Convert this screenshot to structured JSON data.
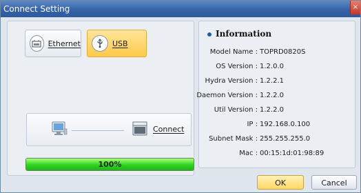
{
  "window": {
    "title": "Connect Setting"
  },
  "connection": {
    "ethernet_label": "Ethernet",
    "usb_label": "USB",
    "connect_label": "Connect"
  },
  "progress": {
    "value": 1.0,
    "label": "100%"
  },
  "information": {
    "title": "Information",
    "rows": [
      {
        "label": "Model Name :",
        "value": "TOPRD0820S"
      },
      {
        "label": "OS Version :",
        "value": "1.2.0.0"
      },
      {
        "label": "Hydra Version :",
        "value": "1.2.2.1"
      },
      {
        "label": "Daemon Version :",
        "value": "1.2.2.0"
      },
      {
        "label": "Util Version :",
        "value": "1.2.2.0"
      },
      {
        "label": "IP :",
        "value": "192.168.0.100"
      },
      {
        "label": "Subnet Mask :",
        "value": "255.255.255.0"
      },
      {
        "label": "Mac :",
        "value": "00:15:1d:01:98:89"
      }
    ]
  },
  "buttons": {
    "ok": "OK",
    "cancel": "Cancel"
  },
  "icons": {
    "ethernet": "ethernet-icon",
    "usb": "usb-icon",
    "computer": "computer-icon",
    "device": "device-icon",
    "close": "close-icon",
    "info_bullet": "bullet-icon"
  }
}
